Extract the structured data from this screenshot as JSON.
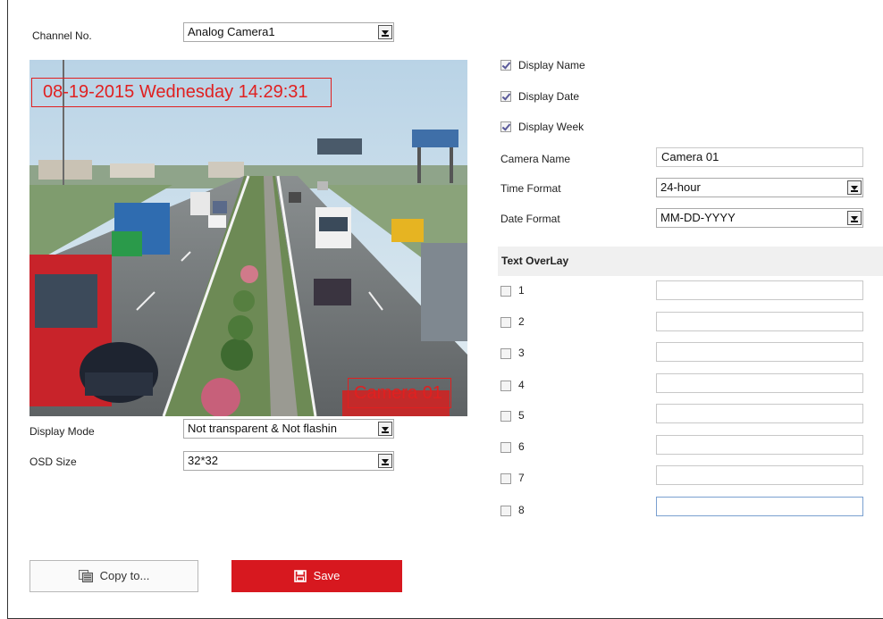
{
  "channel": {
    "label": "Channel No.",
    "value": "Analog Camera1"
  },
  "preview": {
    "osd_datetime": "08-19-2015 Wednesday 14:29:31",
    "osd_camera_name": "Camera 01"
  },
  "display_mode": {
    "label": "Display Mode",
    "value": "Not transparent & Not flashin"
  },
  "osd_size": {
    "label": "OSD Size",
    "value": "32*32"
  },
  "checks": {
    "display_name": {
      "label": "Display Name",
      "checked": true
    },
    "display_date": {
      "label": "Display Date",
      "checked": true
    },
    "display_week": {
      "label": "Display Week",
      "checked": true
    }
  },
  "camera_name": {
    "label": "Camera Name",
    "value": "Camera 01"
  },
  "time_format": {
    "label": "Time Format",
    "value": "24-hour"
  },
  "date_format": {
    "label": "Date Format",
    "value": "MM-DD-YYYY"
  },
  "text_overlay": {
    "title": "Text OverLay",
    "items": [
      {
        "label": "1",
        "value": ""
      },
      {
        "label": "2",
        "value": ""
      },
      {
        "label": "3",
        "value": ""
      },
      {
        "label": "4",
        "value": ""
      },
      {
        "label": "5",
        "value": ""
      },
      {
        "label": "6",
        "value": ""
      },
      {
        "label": "7",
        "value": ""
      },
      {
        "label": "8",
        "value": ""
      }
    ]
  },
  "buttons": {
    "copy_label": "Copy to...",
    "save_label": "Save"
  },
  "colors": {
    "accent": "#d7181f",
    "osd": "#e02020"
  },
  "icons": {
    "copy": "copy-icon",
    "save": "floppy-disk-icon"
  }
}
